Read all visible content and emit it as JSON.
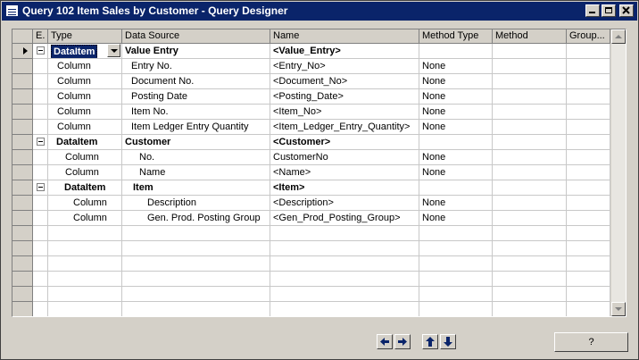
{
  "window": {
    "title": "Query 102 Item Sales by Customer - Query Designer"
  },
  "columns": [
    "E.",
    "Type",
    "Data Source",
    "Name",
    "Method Type",
    "Method",
    "Group..."
  ],
  "rows": [
    {
      "type": "DataItem",
      "source": "Value Entry",
      "name": "<Value_Entry>",
      "method_type": "",
      "bold": true,
      "expand": true,
      "indent": 0
    },
    {
      "type": "Column",
      "source": "Entry No.",
      "name": "<Entry_No>",
      "method_type": "None",
      "bold": false,
      "expand": false,
      "indent": 0
    },
    {
      "type": "Column",
      "source": "Document No.",
      "name": "<Document_No>",
      "method_type": "None",
      "bold": false,
      "expand": false,
      "indent": 0
    },
    {
      "type": "Column",
      "source": "Posting Date",
      "name": "<Posting_Date>",
      "method_type": "None",
      "bold": false,
      "expand": false,
      "indent": 0
    },
    {
      "type": "Column",
      "source": "Item No.",
      "name": "<Item_No>",
      "method_type": "None",
      "bold": false,
      "expand": false,
      "indent": 0
    },
    {
      "type": "Column",
      "source": "Item Ledger Entry Quantity",
      "name": "<Item_Ledger_Entry_Quantity>",
      "method_type": "None",
      "bold": false,
      "expand": false,
      "indent": 0
    },
    {
      "type": "DataItem",
      "source": "Customer",
      "name": "<Customer>",
      "method_type": "",
      "bold": true,
      "expand": true,
      "indent": 0
    },
    {
      "type": "Column",
      "source": "No.",
      "name": "CustomerNo",
      "method_type": "None",
      "bold": false,
      "expand": false,
      "indent": 1
    },
    {
      "type": "Column",
      "source": "Name",
      "name": "<Name>",
      "method_type": "None",
      "bold": false,
      "expand": false,
      "indent": 1
    },
    {
      "type": "DataItem",
      "source": "Item",
      "name": "<Item>",
      "method_type": "",
      "bold": true,
      "expand": true,
      "indent": 1
    },
    {
      "type": "Column",
      "source": "Description",
      "name": "<Description>",
      "method_type": "None",
      "bold": false,
      "expand": false,
      "indent": 2
    },
    {
      "type": "Column",
      "source": "Gen. Prod. Posting Group",
      "name": "<Gen_Prod_Posting_Group>",
      "method_type": "None",
      "bold": false,
      "expand": false,
      "indent": 2
    }
  ],
  "empty_rows": 6,
  "buttons": {
    "help": "?"
  },
  "icons": [
    "window-icon",
    "minimize-icon",
    "maximize-icon",
    "close-icon",
    "arrow-left-icon",
    "arrow-right-icon",
    "arrow-up-icon",
    "arrow-down-icon"
  ]
}
